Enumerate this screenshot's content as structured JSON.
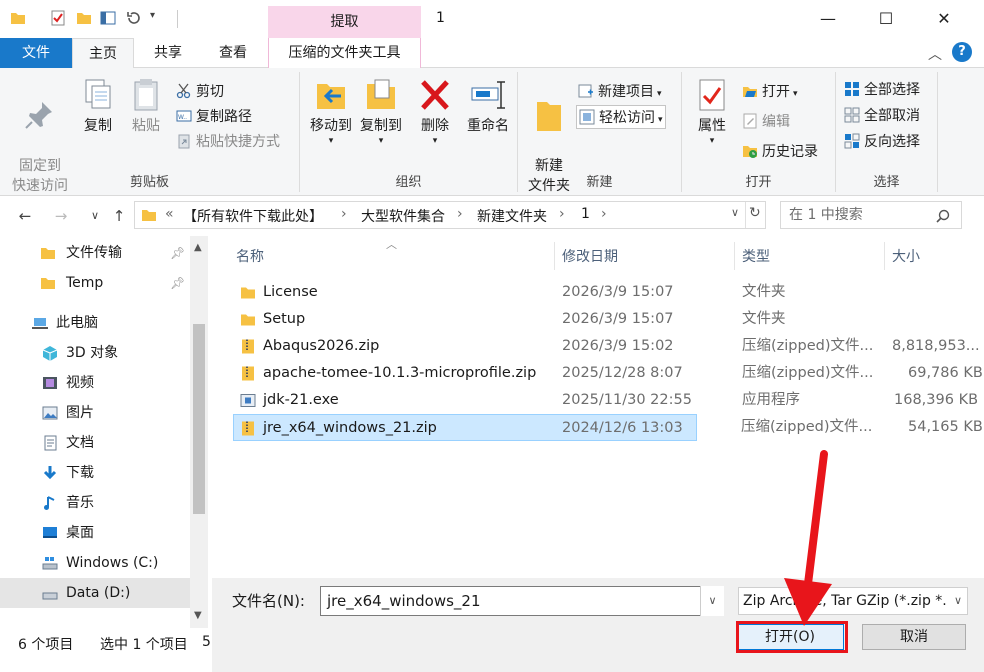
{
  "titlebar": {
    "context_tab": "提取",
    "window_title": "1",
    "minimize": "—",
    "maximize": "☐",
    "close": "✕"
  },
  "tabs": {
    "file": "文件",
    "home": "主页",
    "share": "共享",
    "view": "查看",
    "context_tools": "压缩的文件夹工具"
  },
  "ribbon": {
    "clipboard": {
      "label": "剪贴板",
      "pin_quick_access": "固定到\n快速访问",
      "copy": "复制",
      "paste": "粘贴",
      "cut": "剪切",
      "copy_path": "复制路径",
      "paste_shortcut": "粘贴快捷方式"
    },
    "organize": {
      "label": "组织",
      "move_to": "移动到",
      "copy_to": "复制到",
      "delete": "删除",
      "rename": "重命名"
    },
    "new": {
      "label": "新建",
      "new_folder": "新建\n文件夹",
      "new_item": "新建项目",
      "easy_access": "轻松访问"
    },
    "open": {
      "label": "打开",
      "properties": "属性",
      "open": "打开",
      "edit": "编辑",
      "history": "历史记录"
    },
    "select": {
      "label": "选择",
      "select_all": "全部选择",
      "select_none": "全部取消",
      "invert": "反向选择"
    }
  },
  "address": {
    "breadcrumbs": [
      "«",
      "【所有软件下载此处】",
      "大型软件集合",
      "新建文件夹",
      "1"
    ],
    "search_placeholder": "在 1 中搜索"
  },
  "sidebar": {
    "items": [
      {
        "label": "文件传输",
        "icon": "folder-icon"
      },
      {
        "label": "Temp",
        "icon": "folder-icon"
      },
      {
        "label": "此电脑",
        "icon": "pc-icon"
      },
      {
        "label": "3D 对象",
        "icon": "3d-objects-icon"
      },
      {
        "label": "视频",
        "icon": "video-icon"
      },
      {
        "label": "图片",
        "icon": "pictures-icon"
      },
      {
        "label": "文档",
        "icon": "documents-icon"
      },
      {
        "label": "下载",
        "icon": "download-icon"
      },
      {
        "label": "音乐",
        "icon": "music-icon"
      },
      {
        "label": "桌面",
        "icon": "desktop-icon"
      },
      {
        "label": "Windows (C:)",
        "icon": "drive-c-icon"
      },
      {
        "label": "Data (D:)",
        "icon": "drive-d-icon"
      }
    ]
  },
  "filelist": {
    "columns": [
      "名称",
      "修改日期",
      "类型",
      "大小"
    ],
    "rows": [
      {
        "name": "License",
        "date": "2026/3/9 15:07",
        "type": "文件夹",
        "size": "",
        "icon": "folder"
      },
      {
        "name": "Setup",
        "date": "2026/3/9 15:07",
        "type": "文件夹",
        "size": "",
        "icon": "folder"
      },
      {
        "name": "Abaqus2026.zip",
        "date": "2026/3/9 15:02",
        "type": "压缩(zipped)文件...",
        "size": "8,818,953...",
        "icon": "zip"
      },
      {
        "name": "apache-tomee-10.1.3-microprofile.zip",
        "date": "2025/12/28 8:07",
        "type": "压缩(zipped)文件...",
        "size": "69,786 KB",
        "icon": "zip"
      },
      {
        "name": "jdk-21.exe",
        "date": "2025/11/30 22:55",
        "type": "应用程序",
        "size": "168,396 KB",
        "icon": "exe"
      },
      {
        "name": "jre_x64_windows_21.zip",
        "date": "2024/12/6 13:03",
        "type": "压缩(zipped)文件...",
        "size": "54,165 KB",
        "icon": "zip"
      }
    ]
  },
  "dialog": {
    "filename_label": "文件名(N):",
    "filename_value": "jre_x64_windows_21",
    "filetype_value": "Zip Archive, Tar GZip (*.zip *.",
    "open_button": "打开(O)",
    "cancel_button": "取消"
  },
  "status": {
    "item_count": "6 个项目",
    "selected": "选中 1 个项目",
    "trailing": "5"
  },
  "colors": {
    "accent": "#1979ca",
    "selection": "#cce8ff",
    "context_tab": "#f9d6ea",
    "arrow": "#e8151b"
  }
}
